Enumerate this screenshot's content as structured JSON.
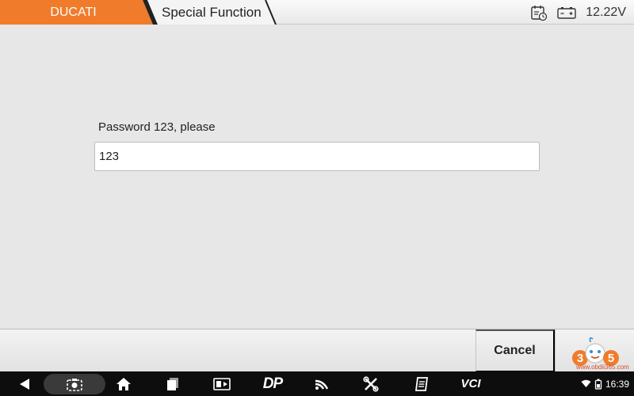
{
  "header": {
    "brand_label": "DUCATI",
    "function_label": "Special Function",
    "voltage": "12.22V",
    "icons": [
      "calendar-clock-icon",
      "battery-icon"
    ]
  },
  "main": {
    "prompt": "Password 123, please",
    "input_value": "123"
  },
  "actions": {
    "cancel_label": "Cancel",
    "logo_text": "305"
  },
  "navbar": {
    "icons": [
      "back-icon",
      "screenshot-icon",
      "home-icon",
      "recent-apps-icon",
      "vehicle-icon",
      "dp-icon",
      "wifi-connect-icon",
      "tools-icon",
      "manual-icon",
      "vci-icon"
    ],
    "dp_label": "DP",
    "vci_label": "VCI",
    "time": "16:39"
  },
  "watermark": "www.obdii365.com",
  "colors": {
    "brand_orange": "#f07c2b",
    "navbar_bg": "#0d0d0d",
    "background": "#e7e7e7"
  }
}
